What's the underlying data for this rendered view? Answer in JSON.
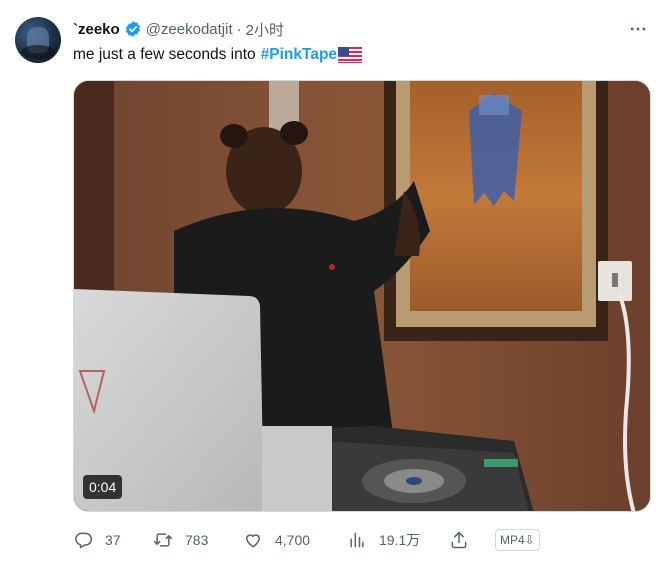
{
  "tweet": {
    "display_name": "`zeeko",
    "handle": "@zeekodatjit",
    "separator": "·",
    "time": "2小时",
    "text": "me just a few seconds into",
    "hashtag": "#PinkTape",
    "video_duration": "0:04"
  },
  "actions": {
    "replies": "37",
    "retweets": "783",
    "likes": "4,700",
    "views": "19.1万",
    "download_label": "MP4⇩"
  },
  "colors": {
    "hashtag": "#1d9bf0",
    "verified_badge": "#1d9bf0",
    "meta_text": "#536471"
  }
}
